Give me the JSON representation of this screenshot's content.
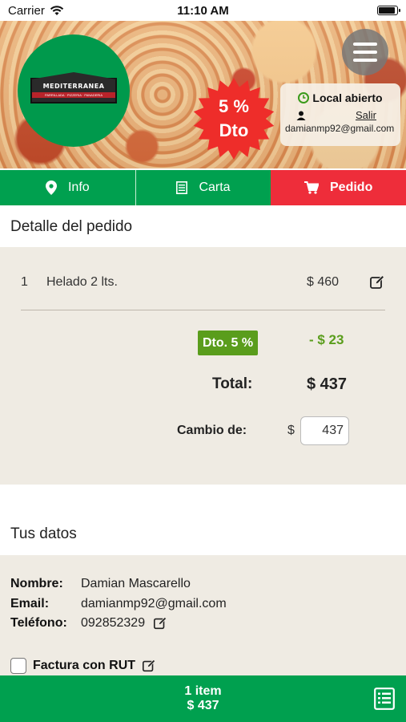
{
  "status_bar": {
    "carrier": "Carrier",
    "time": "11:10 AM",
    "battery_level": 0.95
  },
  "header": {
    "logo_name": "MEDITERRANEA",
    "logo_tagline": "PARRILLADA · PIZZERIA · PANADERIA",
    "discount_line1": "5 %",
    "discount_line2": "Dto",
    "open_status": "Local abierto",
    "logout_label": "Salir",
    "user_email": "damianmp92@gmail.com"
  },
  "tabs": [
    {
      "label": "Info",
      "icon": "location-pin-icon"
    },
    {
      "label": "Carta",
      "icon": "menu-list-icon"
    },
    {
      "label": "Pedido",
      "icon": "cart-icon"
    }
  ],
  "order": {
    "title": "Detalle del pedido",
    "items": [
      {
        "qty": "1",
        "name": "Helado 2 lts.",
        "price": "$ 460"
      }
    ],
    "discount_label": "Dto. 5 %",
    "discount_amount": "- $ 23",
    "total_label": "Total:",
    "total_amount": "$ 437",
    "cambio_label": "Cambio de:",
    "cambio_currency": "$",
    "cambio_value": "437"
  },
  "user_data": {
    "title": "Tus datos",
    "name_label": "Nombre:",
    "name_value": "Damian Mascarello",
    "email_label": "Email:",
    "email_value": "damianmp92@gmail.com",
    "phone_label": "Teléfono:",
    "phone_value": "092852329",
    "rut_label": "Factura con RUT"
  },
  "bottom_bar": {
    "items_count": "1 item",
    "total": "$ 437"
  },
  "colors": {
    "green": "#00a04f",
    "red": "#ee2d3a",
    "discount_green": "#5a9d1c",
    "panel_bg": "#efebe3"
  }
}
